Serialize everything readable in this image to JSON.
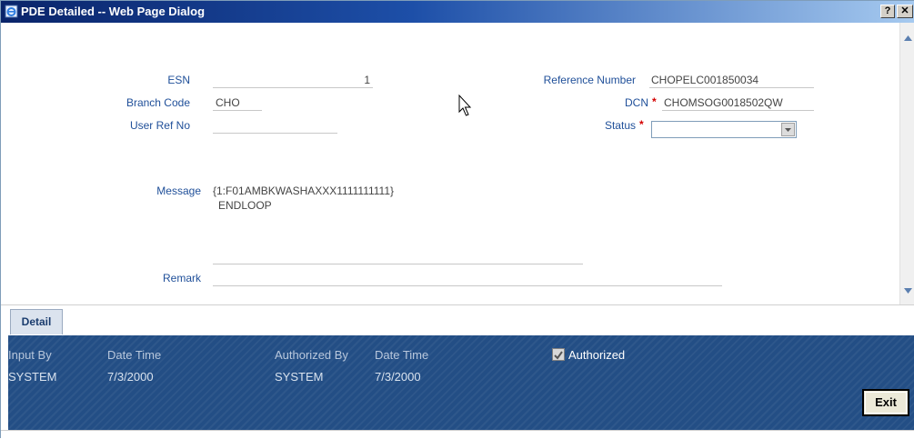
{
  "window": {
    "title": "PDE Detailed -- Web Page Dialog",
    "help_label": "?",
    "close_label": "✕"
  },
  "form": {
    "esn_label": "ESN",
    "esn_value": "1",
    "branch_code_label": "Branch Code",
    "branch_code_value": "CHO",
    "user_ref_label": "User Ref No",
    "user_ref_value": "",
    "reference_number_label": "Reference Number",
    "reference_number_value": "CHOPELC001850034",
    "dcn_label": "DCN",
    "dcn_value": "CHOMSOG0018502QW",
    "status_label": "Status",
    "status_value": "",
    "required_marker": "*",
    "message_label": "Message",
    "message_line1": "{1:F01AMBKWASHAXXX1111111111}",
    "message_line2": "ENDLOOP",
    "remark_label": "Remark",
    "remark_value": ""
  },
  "tabs": [
    {
      "label": "Detail"
    }
  ],
  "audit": {
    "input_by_label": "Input By",
    "input_by_value": "SYSTEM",
    "date_time_label_1": "Date Time",
    "date_time_value_1": "7/3/2000",
    "authorized_by_label": "Authorized By",
    "authorized_by_value": "SYSTEM",
    "date_time_label_2": "Date Time",
    "date_time_value_2": "7/3/2000",
    "authorized_label": "Authorized",
    "authorized_checked": true
  },
  "actions": {
    "exit_label": "Exit"
  },
  "colors": {
    "titlebar_start": "#0a246a",
    "label_blue": "#1f4f99",
    "footer_bg": "#234e85",
    "required_red": "#d40000"
  }
}
